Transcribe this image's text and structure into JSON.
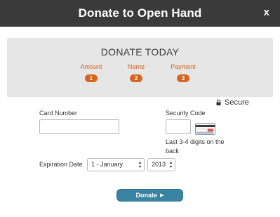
{
  "modal": {
    "title": "Donate to Open Hand",
    "close_label": "x"
  },
  "banner": {
    "title": "DONATE TODAY",
    "steps": [
      {
        "label": "Amount",
        "number": "1"
      },
      {
        "label": "Name",
        "number": "2"
      },
      {
        "label": "Payment",
        "number": "3"
      }
    ]
  },
  "secure_label": "Secure",
  "form": {
    "card_number_label": "Card Number",
    "card_number_value": "",
    "security_code_label": "Security Code",
    "security_code_value": "",
    "security_help": "Last 3-4 digits on the back",
    "expiration_label": "Expiration Date",
    "month_selected": "1 - January",
    "year_selected": "2013",
    "donate_label": "Donate"
  },
  "colors": {
    "header": "#3a3a3a",
    "accent": "#d9651b",
    "button": "#3a84a3",
    "banner": "#e6e6e6"
  },
  "icons": {
    "close": "close-icon",
    "lock": "lock-icon",
    "card": "card-security-icon",
    "arrow": "caret-right-icon"
  }
}
